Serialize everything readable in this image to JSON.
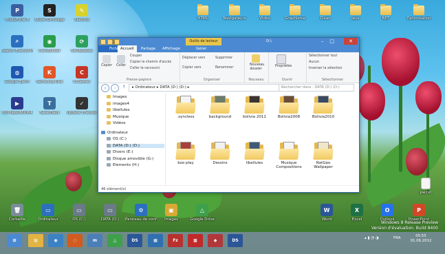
{
  "desktop_icons_top": [
    {
      "label": "PhotoFiltre 6",
      "color": "#3a5fa0",
      "glyph": "P"
    },
    {
      "label": "ShowTOPImage",
      "color": "#222222",
      "glyph": "S"
    },
    {
      "label": "Sketchy",
      "color": "#d8d22f",
      "glyph": "✎"
    },
    {
      "label": "Search Everything",
      "color": "#2b6fbf",
      "glyph": "⌕"
    },
    {
      "label": "CamBuilder",
      "color": "#2a9d4b",
      "glyph": "◉"
    },
    {
      "label": "SetUpdates",
      "color": "#2ca05f",
      "glyph": "⟳"
    },
    {
      "label": "Google Earth",
      "color": "#1f57b1",
      "glyph": "◍"
    },
    {
      "label": "Samsung Kies",
      "color": "#e25628",
      "glyph": "K"
    },
    {
      "label": "CCleaner",
      "color": "#c53626",
      "glyph": "C"
    },
    {
      "label": "PotPlayerMini64",
      "color": "#2b3c8f",
      "glyph": "▶"
    },
    {
      "label": "TweetDeck",
      "color": "#3a6f9c",
      "glyph": "T"
    },
    {
      "label": "Update Checker",
      "color": "#333333",
      "glyph": "✓"
    }
  ],
  "desktop_folders_top": [
    {
      "label": "HTML"
    },
    {
      "label": "Navigateurs"
    },
    {
      "label": "Vidéo"
    },
    {
      "label": "Graphisme"
    },
    {
      "label": "Clean"
    },
    {
      "label": "Jeux"
    },
    {
      "label": "NET"
    },
    {
      "label": "Optimisation"
    }
  ],
  "desktop_icons_bottom": [
    {
      "label": "Corbeille",
      "color": "#7a8b99",
      "glyph": "🗑"
    },
    {
      "label": "Ordinateur",
      "color": "#2b6fbf",
      "glyph": "▭"
    },
    {
      "label": "OS (C:)",
      "color": "#6a7a88",
      "glyph": "▭"
    },
    {
      "label": "DATA (D:)",
      "color": "#6a7a88",
      "glyph": "▭"
    },
    {
      "label": "Panneau de configuration",
      "color": "#2b6fbf",
      "glyph": "⚙"
    },
    {
      "label": "Images",
      "color": "#d8a935",
      "glyph": "▣"
    },
    {
      "label": "Google Drive",
      "color": "#3fa04c",
      "glyph": "△"
    },
    {
      "label": "Word",
      "color": "#2b5797",
      "glyph": "W"
    },
    {
      "label": "Excel",
      "color": "#1e7145",
      "glyph": "X"
    },
    {
      "label": "Outlook",
      "color": "#2672ec",
      "glyph": "O"
    },
    {
      "label": "PowerPoint",
      "color": "#d24726",
      "glyph": "P"
    }
  ],
  "desktop_pw_file": {
    "label": "pw.txt"
  },
  "explorer": {
    "quick_tools": "Outils de lecteur",
    "title": "D:\\",
    "controls": {
      "min": "–",
      "max": "□",
      "close": "✕"
    },
    "tabs": [
      "Fichier",
      "Accueil",
      "Partage",
      "Affichage",
      "Gérer"
    ],
    "ribbon": {
      "clipboard": {
        "copy": "Copier",
        "paste": "Coller",
        "cut": "Couper",
        "copy_path": "Copier le chemin d'accès",
        "paste_shortcut": "Coller le raccourci",
        "group": "Presse-papiers"
      },
      "organize": {
        "move": "Déplacer vers",
        "copy_to": "Copier vers",
        "delete": "Supprimer",
        "rename": "Renommer",
        "group": "Organiser"
      },
      "new": {
        "new_folder": "Nouveau dossier",
        "group": "Nouveau"
      },
      "open": {
        "properties": "Propriétés",
        "group": "Ouvrir"
      },
      "select": {
        "select_all": "Sélectionner tout",
        "none": "Aucun",
        "invert": "Inverser la sélection",
        "group": "Sélectionner"
      }
    },
    "address": {
      "path": "▸ Ordinateur ▸ DATA (D:) (D:) ▸",
      "search_placeholder": "Rechercher dans : DATA (D:) (D:)"
    },
    "nav_items": [
      {
        "label": "Images",
        "level": 1
      },
      {
        "label": "images4",
        "level": 1
      },
      {
        "label": "libellules",
        "level": 1
      },
      {
        "label": "Musique",
        "level": 1
      },
      {
        "label": "Vidéos",
        "level": 1
      },
      {
        "label": "Ordinateur",
        "level": 0
      },
      {
        "label": "OS (C:)",
        "level": 1
      },
      {
        "label": "DATA (D:) (D:)",
        "level": 1,
        "selected": true
      },
      {
        "label": "Divers (E:)",
        "level": 1
      },
      {
        "label": "Disque amovible (G:)",
        "level": 1
      },
      {
        "label": "Elements (H:)",
        "level": 1
      }
    ],
    "files": [
      {
        "name": ".syncless",
        "paper": "#f4f4f4"
      },
      {
        "name": "background",
        "paper": "#6b7d6a"
      },
      {
        "name": "bolivia 2011",
        "paper": "#3b3330"
      },
      {
        "name": "Bolivia2008",
        "paper": "#6b4e3a"
      },
      {
        "name": "Bolivia2010",
        "paper": "#3a4a63"
      },
      {
        "name": "box-play",
        "paper": "#a9413b"
      },
      {
        "name": "Dessins",
        "paper": "#f1f1f1"
      },
      {
        "name": "libellules",
        "paper": "#3e5a78"
      },
      {
        "name": "Musique Compositions",
        "paper": "#f4f4f4"
      },
      {
        "name": "NatGeo Wallpaper",
        "paper": "#f0e6c8"
      }
    ],
    "status": "46 élément(s)"
  },
  "taskbar": {
    "items": [
      {
        "name": "start",
        "color": "#4b8ad2",
        "glyph": "⊞"
      },
      {
        "name": "explorer",
        "color": "#e3b442",
        "glyph": "▤"
      },
      {
        "name": "chrome",
        "color": "#3b82c5",
        "glyph": "◉"
      },
      {
        "name": "firefox",
        "color": "#d25b1f",
        "glyph": "◌"
      },
      {
        "name": "app1",
        "color": "#4c7fb8",
        "glyph": "m"
      },
      {
        "name": "drive",
        "color": "#3fa04c",
        "glyph": "△"
      },
      {
        "name": "app2",
        "color": "#2b5797",
        "glyph": "DS"
      },
      {
        "name": "app3",
        "color": "#3070b0",
        "glyph": "▦"
      },
      {
        "name": "filezilla",
        "color": "#b8312f",
        "glyph": "Fz"
      },
      {
        "name": "app4",
        "color": "#c02a2a",
        "glyph": "▩"
      },
      {
        "name": "app5",
        "color": "#b0383a",
        "glyph": "◆"
      },
      {
        "name": "app6",
        "color": "#2b5797",
        "glyph": "DS"
      }
    ],
    "lang": "FRA",
    "time": "05:55",
    "date": "01.06.2012"
  },
  "watermark": {
    "line1": "Windows 8 Release Preview",
    "line2": "Version d'évaluation. Build 8400"
  }
}
